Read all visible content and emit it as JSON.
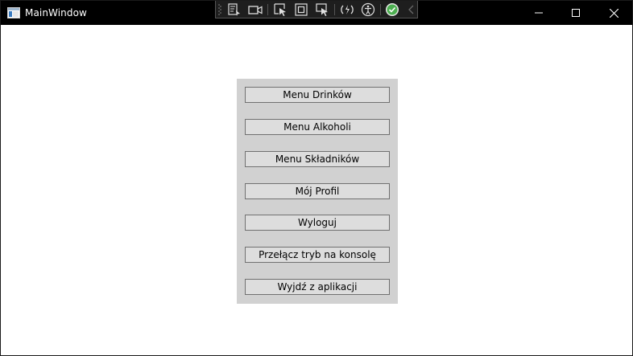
{
  "window": {
    "title": "MainWindow",
    "background": "#ffffff",
    "titlebar_color": "#000000"
  },
  "caption_buttons": {
    "minimize_icon": "minimize-icon",
    "maximize_icon": "maximize-icon",
    "close_icon": "close-icon"
  },
  "debug_toolbar": {
    "items": [
      "live-visual-tree-icon",
      "record-icon",
      "select-element-icon",
      "display-layout-adorners-icon",
      "track-focused-element-icon",
      "hot-reload-icon",
      "accessibility-icon",
      "binding-check-icon",
      "collapse-chevron-icon"
    ],
    "check_color": "#4caf50"
  },
  "menu": {
    "panel_color": "#d1d1d1",
    "buttons": [
      "Menu Drinków",
      "Menu Alkoholi",
      "Menu Składników",
      "Mój Profil",
      "Wyloguj",
      "Przełącz tryb na konsolę",
      "Wyjdź z aplikacji"
    ]
  }
}
